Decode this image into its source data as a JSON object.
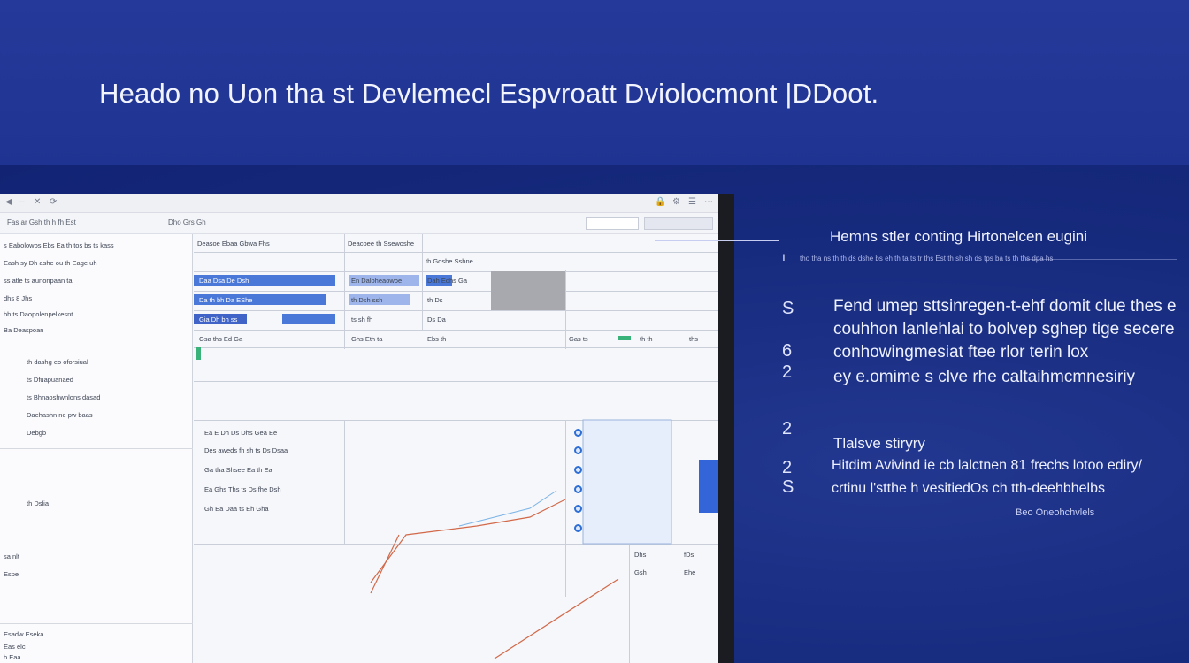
{
  "headline": "Heado no Uon tha st Devlemecl Espvroatt Dviolocmont |DDoot.",
  "app_window": {
    "toolbar": {
      "left_text": "Fas ar Gsh  th h   fh   Est",
      "right_text": "Dho  Grs  Gh"
    },
    "sidebar": {
      "rows": [
        "s Eabolowos Ebs Ea  th  tos bs  ts kass",
        "Eash sy  Dh  ashe ou th   Eage  uh",
        "ss  atle ts  aunonpaan  ta",
        "dhs  8 Jhs",
        "hh  ts  Daopolenpelkesnt",
        "Ba  Deaspoan",
        "th  dashg eo oforsiual",
        "ts  Dfuapuanaed",
        "ts  Bhnaoshwnlons dasad",
        "Daehashn ne pw baas",
        "Debgb",
        "th  Dslia",
        "sa  nlt",
        "Espe"
      ],
      "bottom_rows": [
        "Esadw Eseka",
        "Eas  elc",
        "h Eaa"
      ]
    },
    "grid": {
      "header_row": [
        "Deasoe Ebaa Gbwa Fhs",
        "Deacoee th Ssewoshe",
        "th Goshe Ssbne"
      ],
      "row2": [
        "Daa Dsa  De Dsh",
        "En  Daloheaowoe",
        "Dah  Edhs  Ga"
      ],
      "row3": [
        "Da  th  bh  Da  EShe",
        "th Dsh ssh",
        "th Ds"
      ],
      "row4": [
        "Gia Dh  bh ss",
        "ts  sh fh",
        "Ds  Da"
      ],
      "row5": [
        "Gsa  ths  Ed  Ga",
        "Ghs  Eth  ta",
        "Ebs  th",
        "Gas  ts",
        "th  th",
        "ths"
      ]
    },
    "lower": {
      "rows": [
        "Ea  E  Dh  Ds  Dhs  Gea  Ee",
        "Des aweds fh  sh  ts  Ds  Dsaa",
        "Ga  tha  Shsee  Ea  th  Ea",
        "Ea  Ghs  Ths  ts  Ds  fhe  Dsh",
        "Gh  Ea  Daa  ts  Eh  Gha"
      ],
      "side_values": [
        "Dhs",
        "fDs",
        "Gsh",
        "Ehe"
      ]
    }
  },
  "right_panel": {
    "intro": "Hemns stler conting  Hirtonelcen  eugini",
    "intro_sub": "tho tha ns th th ds dshe bs eh th ta ts tr ths Est th sh sh ds tps ba ts th ths dpa hs",
    "items": [
      {
        "num": "S",
        "lines": [
          "Fend umep sttsinregen-t-ehf domit clue thes e",
          "couhhon lanlehlai to bolvep sghep tige secere"
        ]
      },
      {
        "num": "6",
        "lines": [
          "conhowingmesiat ftee rlor terin lox"
        ]
      },
      {
        "num": "2",
        "lines": [
          "ey e.omime s clve rhe caltaihmcmnesiriy"
        ]
      },
      {
        "num": "2",
        "lines": [
          "Tlalsve stiryry"
        ]
      },
      {
        "num": "2",
        "lines": [
          "Hitdim Avivind ie cb lalctnen  81 frechs lotoo ediry/"
        ]
      },
      {
        "num": "S",
        "lines": [
          "crtinu l'stthe h  vesitiedOs  ch  tth-deehbhelbs"
        ]
      }
    ],
    "footnote": "Beo  Oneohchvlels"
  }
}
